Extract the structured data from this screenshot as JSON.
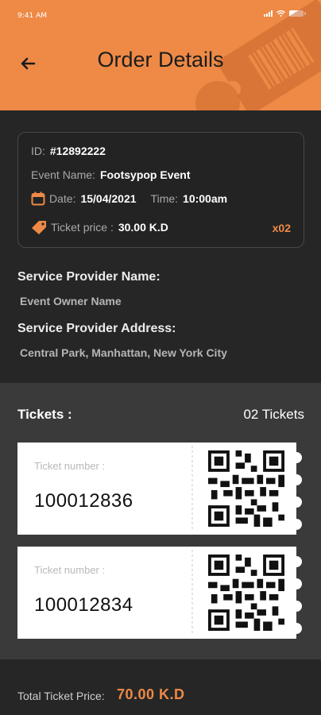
{
  "status_bar": {
    "time": "9:41 AM"
  },
  "header": {
    "title": "Order Details"
  },
  "order": {
    "id_label": "ID:",
    "id_value": "#12892222",
    "event_label": "Event Name:",
    "event_value": "Footsypop Event",
    "date_label": "Date:",
    "date_value": "15/04/2021",
    "time_label": "Time:",
    "time_value": "10:00am",
    "price_label": "Ticket price :",
    "price_value": "30.00 K.D",
    "quantity": "x02"
  },
  "provider": {
    "name_label": "Service Provider Name:",
    "name_value": "Event Owner Name",
    "address_label": "Service Provider Address:",
    "address_value": "Central Park, Manhattan, New York City"
  },
  "tickets": {
    "label": "Tickets :",
    "count": "02 Tickets",
    "items": [
      {
        "number_label": "Ticket number :",
        "number": "100012836"
      },
      {
        "number_label": "Ticket number :",
        "number": "100012834"
      }
    ]
  },
  "total": {
    "label": "Total Ticket Price:",
    "value": "70.00 K.D"
  },
  "colors": {
    "accent": "#ee8a46",
    "background": "#262626",
    "section": "#3a3a3a"
  }
}
